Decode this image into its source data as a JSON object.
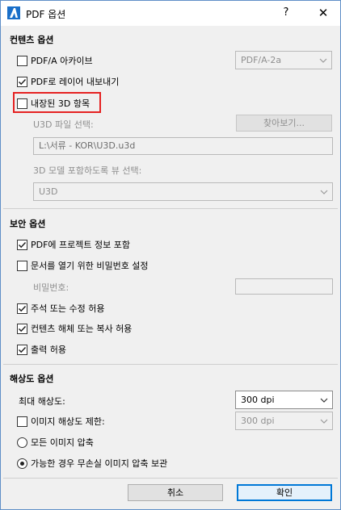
{
  "window": {
    "title": "PDF 옵션",
    "help_label": "?",
    "close_label": "✕"
  },
  "content_options": {
    "title": "컨텐츠 옵션",
    "pdfa": {
      "label": "PDF/A 아카이브",
      "checked": false,
      "dropdown_value": "PDF/A-2a"
    },
    "export_layers": {
      "label": "PDF로 레이어 내보내기",
      "checked": true
    },
    "embedded_3d": {
      "label": "내장된 3D 항목",
      "checked": false
    },
    "u3d_file_label": "U3D 파일 선택:",
    "browse_label": "찾아보기...",
    "u3d_path": "L:\\서류 - KOR\\U3D.u3d",
    "model_view_label": "3D 모델 포함하도록 뷰 선택:",
    "model_view_value": "U3D"
  },
  "security_options": {
    "title": "보안 옵션",
    "include_project_info": {
      "label": "PDF에 프로젝트 정보 포함",
      "checked": true
    },
    "password_to_open": {
      "label": "문서를 열기 위한 비밀번호 설정",
      "checked": false
    },
    "password_label": "비밀번호:",
    "password_value": "",
    "allow_comments": {
      "label": "주석 또는 수정 허용",
      "checked": true
    },
    "allow_copy": {
      "label": "컨텐츠 해체 또는 복사 허용",
      "checked": true
    },
    "allow_print": {
      "label": "출력 허용",
      "checked": true
    }
  },
  "resolution_options": {
    "title": "해상도 옵션",
    "max_resolution_label": "최대 해상도:",
    "max_resolution_value": "300 dpi",
    "limit_image": {
      "label": "이미지 해상도 제한:",
      "checked": false,
      "dropdown_value": "300 dpi"
    },
    "compress_all": {
      "label": "모든 이미지 압축",
      "selected": false
    },
    "lossless": {
      "label": "가능한 경우 무손실 이미지 압축 보관",
      "selected": true
    }
  },
  "footer": {
    "cancel_label": "취소",
    "ok_label": "확인"
  },
  "colors": {
    "highlight": "#e52222",
    "primary_border": "#0078d7",
    "window_border": "#5f8fc7"
  }
}
